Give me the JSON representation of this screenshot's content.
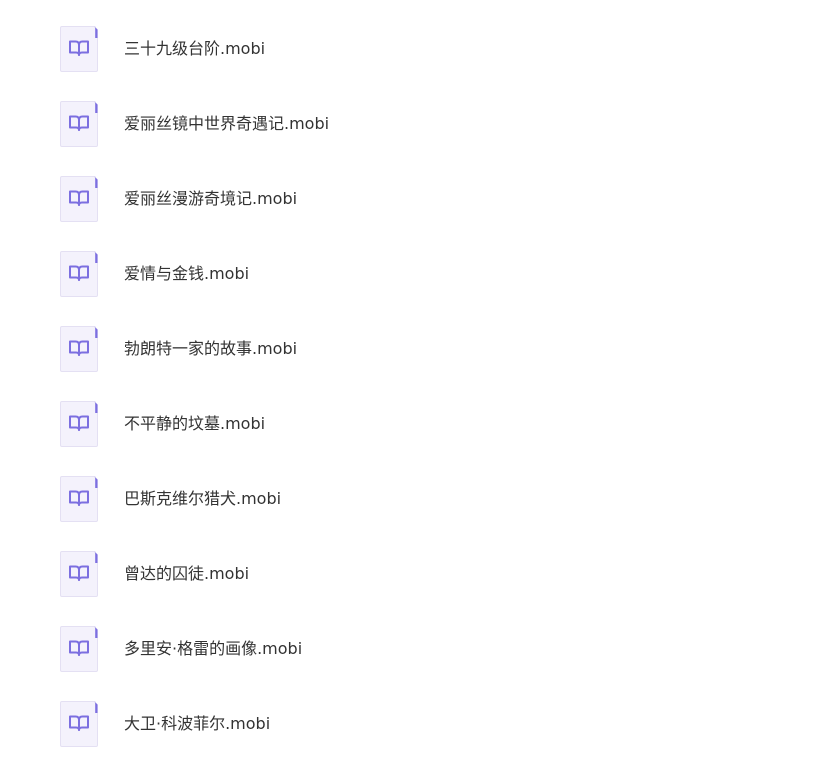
{
  "icon": "ebook-file-icon",
  "colors": {
    "icon_fill": "#f4f2fc",
    "icon_border": "#e4e0f3",
    "icon_corner": "#7c6fe0",
    "icon_glyph": "#7c6fe0",
    "text": "#333333",
    "background": "#ffffff"
  },
  "files": [
    {
      "name": "三十九级台阶.mobi"
    },
    {
      "name": "爱丽丝镜中世界奇遇记.mobi"
    },
    {
      "name": "爱丽丝漫游奇境记.mobi"
    },
    {
      "name": "爱情与金钱.mobi"
    },
    {
      "name": "勃朗特一家的故事.mobi"
    },
    {
      "name": "不平静的坟墓.mobi"
    },
    {
      "name": "巴斯克维尔猎犬.mobi"
    },
    {
      "name": "曾达的囚徒.mobi"
    },
    {
      "name": "多里安·格雷的画像.mobi"
    },
    {
      "name": "大卫·科波菲尔.mobi"
    }
  ]
}
